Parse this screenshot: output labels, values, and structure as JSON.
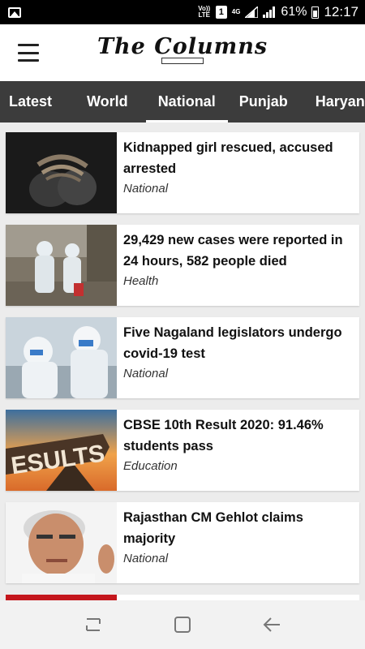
{
  "status_bar": {
    "volte": "Vo)) LTE",
    "sim_slot": "1",
    "network": "4G",
    "battery": "61%",
    "time": "12:17"
  },
  "app": {
    "title": "The Columns"
  },
  "tabs": [
    {
      "label": "Latest",
      "active": false
    },
    {
      "label": "World",
      "active": false
    },
    {
      "label": "National",
      "active": true
    },
    {
      "label": "Punjab",
      "active": false
    },
    {
      "label": "Haryana",
      "active": false
    }
  ],
  "articles": [
    {
      "title": "Kidnapped girl rescued, accused arrested",
      "category": "National",
      "image": "bound-hands-photo"
    },
    {
      "title": "29,429 new cases were reported in 24 hours, 582 people died",
      "category": "Health",
      "image": "ppe-workers-street-photo"
    },
    {
      "title": "Five Nagaland legislators undergo covid-19 test",
      "category": "National",
      "image": "ppe-lab-photo"
    },
    {
      "title": "CBSE 10th Result 2020: 91.46% students pass",
      "category": "Education",
      "image": "results-signpost-photo"
    },
    {
      "title": "Rajasthan CM Gehlot claims majority",
      "category": "National",
      "image": "politician-portrait-photo"
    }
  ],
  "nav": {
    "recent": "recent-apps-icon",
    "home": "home-icon",
    "back": "back-icon"
  }
}
